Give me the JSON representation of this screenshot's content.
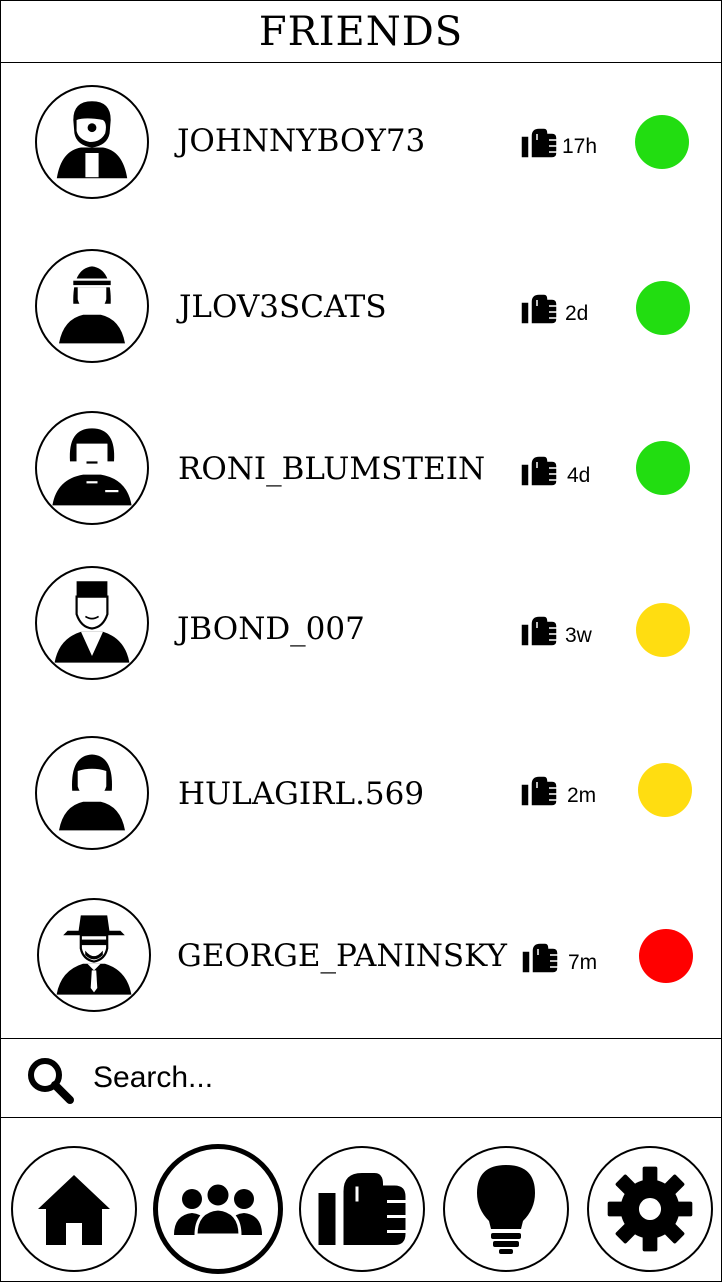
{
  "header": {
    "title": "FRIENDS"
  },
  "friends": [
    {
      "name": "JOHNNYBOY73",
      "last_seen": "17h",
      "status_color": "#22dd11",
      "avatar_icon": "man-avatar-icon"
    },
    {
      "name": "JLOV3SCATS",
      "last_seen": "2d",
      "status_color": "#22dd11",
      "avatar_icon": "woman-headband-avatar-icon"
    },
    {
      "name": "RONI_BLUMSTEIN",
      "last_seen": "4d",
      "status_color": "#22dd11",
      "avatar_icon": "woman-bob-avatar-icon"
    },
    {
      "name": "JBOND_007",
      "last_seen": "3w",
      "status_color": "#ffdd11",
      "avatar_icon": "man-fez-avatar-icon"
    },
    {
      "name": "HULAGIRL.569",
      "last_seen": "2m",
      "status_color": "#ffdd11",
      "avatar_icon": "woman-avatar-icon"
    },
    {
      "name": "GEORGE_PANINSKY",
      "last_seen": "7m",
      "status_color": "#ff0000",
      "avatar_icon": "man-hat-avatar-icon"
    }
  ],
  "search": {
    "placeholder": "Search..."
  },
  "nav": [
    {
      "icon": "home-icon",
      "active": false
    },
    {
      "icon": "friends-icon",
      "active": true
    },
    {
      "icon": "fist-icon",
      "active": false
    },
    {
      "icon": "lightbulb-icon",
      "active": false
    },
    {
      "icon": "gear-icon",
      "active": false
    }
  ]
}
